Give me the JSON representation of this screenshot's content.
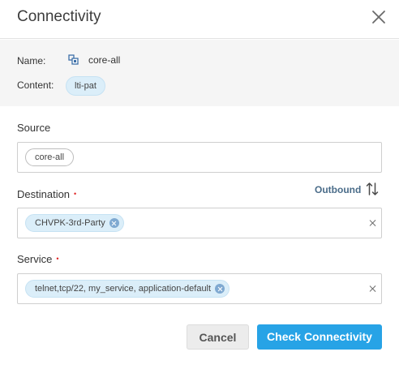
{
  "dialog": {
    "title": "Connectivity"
  },
  "info": {
    "name_label": "Name:",
    "name_value": "core-all",
    "content_label": "Content:",
    "content_chip": "lti-pat"
  },
  "source": {
    "label": "Source",
    "chip": "core-all"
  },
  "destination": {
    "label": "Destination",
    "required_mark": "•",
    "chip": "CHVPK-3rd-Party",
    "direction_label": "Outbound"
  },
  "service": {
    "label": "Service",
    "required_mark": "•",
    "chip": "telnet,tcp/22, my_service, application-default"
  },
  "actions": {
    "cancel_label": "Cancel",
    "check_label": "Check Connectivity"
  },
  "colors": {
    "primary": "#27a3e6",
    "chip_bg": "#dbeef9",
    "required": "#e02424",
    "link": "#4a6c89"
  }
}
